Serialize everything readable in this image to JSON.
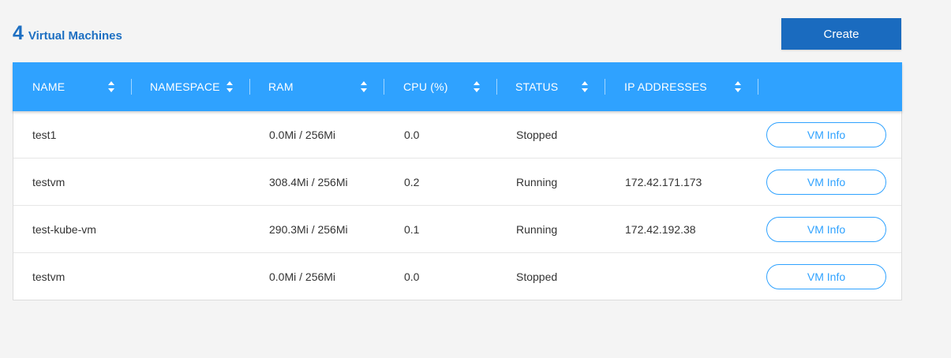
{
  "header": {
    "count": "4",
    "title": "Virtual Machines",
    "create_label": "Create"
  },
  "colors": {
    "accent": "#2fa2ff",
    "brand": "#1a6bbf",
    "title": "#1d6fc2"
  },
  "table": {
    "columns": [
      {
        "label": "NAME",
        "sortable": true,
        "icon": "sort-icon"
      },
      {
        "label": "NAMESPACE",
        "sortable": true,
        "icon": "sort-icon"
      },
      {
        "label": "RAM",
        "sortable": true,
        "icon": "sort-icon"
      },
      {
        "label": "CPU (%)",
        "sortable": true,
        "icon": "sort-icon"
      },
      {
        "label": "STATUS",
        "sortable": true,
        "icon": "sort-icon"
      },
      {
        "label": "IP ADDRESSES",
        "sortable": true,
        "icon": "sort-icon"
      }
    ],
    "rows": [
      {
        "name": "test1",
        "namespace": "",
        "ram": "0.0Mi / 256Mi",
        "cpu": "0.0",
        "status": "Stopped",
        "ip": "",
        "action": "VM Info"
      },
      {
        "name": "testvm",
        "namespace": "",
        "ram": "308.4Mi / 256Mi",
        "cpu": "0.2",
        "status": "Running",
        "ip": "172.42.171.173",
        "action": "VM Info"
      },
      {
        "name": "test-kube-vm",
        "namespace": "",
        "ram": "290.3Mi / 256Mi",
        "cpu": "0.1",
        "status": "Running",
        "ip": "172.42.192.38",
        "action": "VM Info"
      },
      {
        "name": "testvm",
        "namespace": "",
        "ram": "0.0Mi / 256Mi",
        "cpu": "0.0",
        "status": "Stopped",
        "ip": "",
        "action": "VM Info"
      }
    ]
  }
}
